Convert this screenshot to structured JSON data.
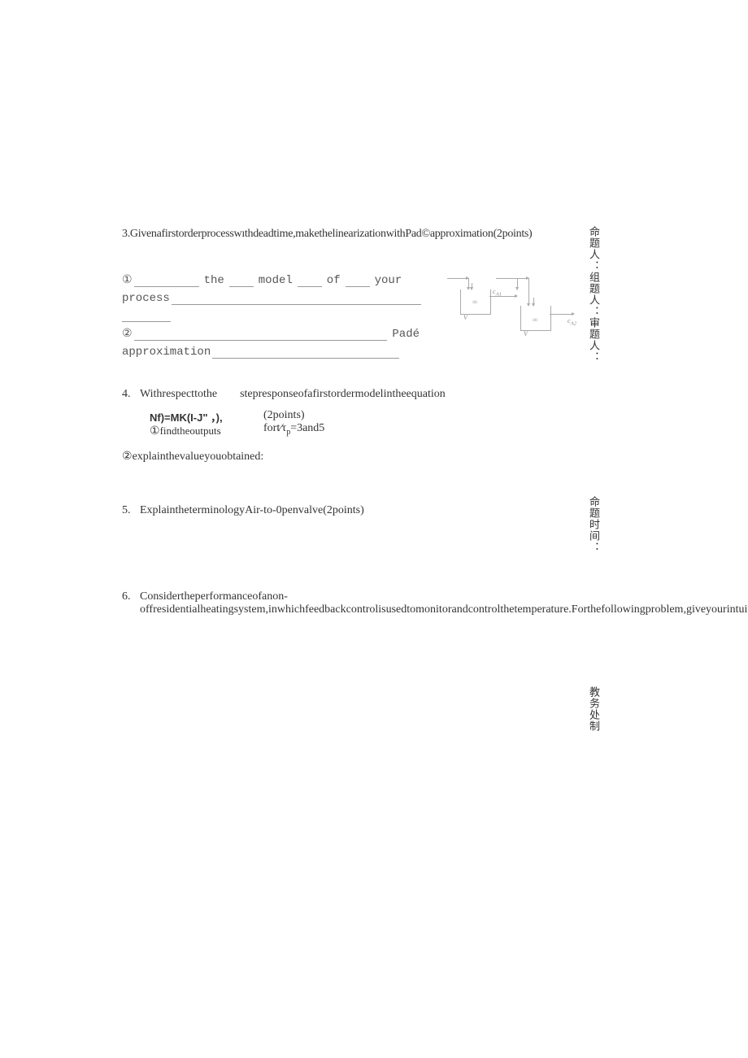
{
  "q3": {
    "text": "3.Givenafirstorderprocesswıthdeadtime,makethelinearizationwithPad©approximation(2points)",
    "item1_mark": "①",
    "item1_w1": "the",
    "item1_w2": "model",
    "item1_w3": "of",
    "item1_w4": "your",
    "item1_process": "process",
    "item2_mark": "②",
    "item2_pade": "Padé",
    "item2_approx": "approximation",
    "diagram": {
      "cA1": "c_A1",
      "cA2": "c_A2",
      "V": "V"
    }
  },
  "q4": {
    "num": "4.",
    "line1": "Withrespecttothe        stepresponseofafirstordermodelintheequation",
    "eq": "Nf)=MK(I-J\" ，),",
    "points": "(2points)",
    "sub1_mark": "①",
    "sub1_text": "findtheoutputs",
    "sub1_right": "fort⁄τ",
    "sub1_p": "p",
    "sub1_after": "=3and5",
    "sub2_mark": "②",
    "sub2_text": "explainthevalueyouobtained:"
  },
  "q5": {
    "num": "5.",
    "text": "ExplaintheterminologyAir-to-0penvalve(2points)"
  },
  "q6": {
    "num": "6.",
    "text": "Considertheperformanceofanon-offresidentialheatingsystem,inwhichfeedbackcontrolisusedtomonitorandcontrolthetemperature.Forthefollowingproblem,giveyourintuitiveanswer."
  },
  "side": {
    "s1": "命题人：组题人：审题人：",
    "s2": "命题时间：",
    "s3": "教务处制"
  }
}
